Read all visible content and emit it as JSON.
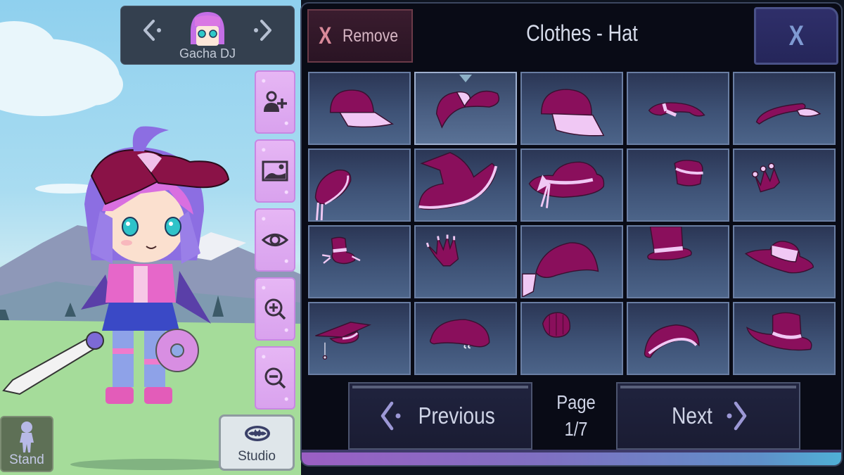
{
  "character": {
    "name": "Gacha DJ",
    "prev_icon": "chevron-left-dot-icon",
    "next_icon": "chevron-right-dot-icon"
  },
  "side_tools": [
    {
      "id": "add-character",
      "icon": "add-person-icon"
    },
    {
      "id": "background",
      "icon": "landscape-image-icon"
    },
    {
      "id": "view",
      "icon": "eye-icon"
    },
    {
      "id": "zoom-in",
      "icon": "zoom-in-icon"
    },
    {
      "id": "zoom-out",
      "icon": "zoom-out-icon"
    }
  ],
  "bottom_left": {
    "stand_label": "Stand",
    "studio_label": "Studio"
  },
  "panel": {
    "remove_x": "X",
    "remove_label": "Remove",
    "title": "Clothes - Hat",
    "close_label": "X",
    "items": [
      {
        "name": "Baseball cap",
        "selected": false
      },
      {
        "name": "Backwards cap",
        "selected": true
      },
      {
        "name": "Baseball cap (front)",
        "selected": false
      },
      {
        "name": "Striped visor",
        "selected": false
      },
      {
        "name": "Visor",
        "selected": false
      },
      {
        "name": "Beret with strings",
        "selected": false
      },
      {
        "name": "Witch hat",
        "selected": false
      },
      {
        "name": "Sun hat with bow",
        "selected": false
      },
      {
        "name": "Small pillbox hat",
        "selected": false
      },
      {
        "name": "Mini crown",
        "selected": false
      },
      {
        "name": "Mini top hat",
        "selected": false
      },
      {
        "name": "Spiked crown",
        "selected": false
      },
      {
        "name": "Bandana",
        "selected": false
      },
      {
        "name": "Top hat",
        "selected": false
      },
      {
        "name": "Wide brim hat",
        "selected": false
      },
      {
        "name": "Graduation cap",
        "selected": false
      },
      {
        "name": "Beret",
        "selected": false
      },
      {
        "name": "Knit beanie",
        "selected": false
      },
      {
        "name": "Slouch beanie",
        "selected": false
      },
      {
        "name": "Fedora",
        "selected": false
      }
    ],
    "previous_label": "Previous",
    "next_label": "Next",
    "page_label": "Page",
    "page_value": "1/7",
    "current_page": 1,
    "total_pages": 7
  },
  "colors": {
    "hat_fill": "#8a0f5c",
    "hat_trim": "#f0c8f4",
    "tool_button": "#dca6ef",
    "panel_bg": "#090b16"
  }
}
